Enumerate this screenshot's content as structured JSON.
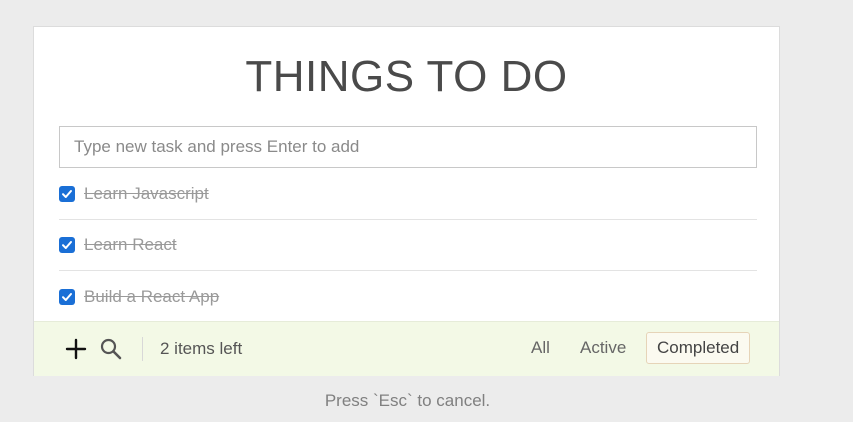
{
  "app": {
    "title": "THINGS TO DO"
  },
  "new_task": {
    "placeholder": "Type new task and press Enter to add",
    "value": ""
  },
  "todos": [
    {
      "label": "Learn Javascript",
      "completed": true
    },
    {
      "label": "Learn React",
      "completed": true
    },
    {
      "label": "Build a React App",
      "completed": true
    }
  ],
  "footer": {
    "add_icon": "plus-icon",
    "search_icon": "search-icon",
    "items_left": "2 items left",
    "filters": [
      "All",
      "Active",
      "Completed"
    ],
    "selected_filter": "Completed"
  },
  "hint": "Press `Esc` to cancel.",
  "colors": {
    "checkbox": "#1a6fd6",
    "footer_bg": "#f3f9e6",
    "page_bg": "#ececec"
  }
}
